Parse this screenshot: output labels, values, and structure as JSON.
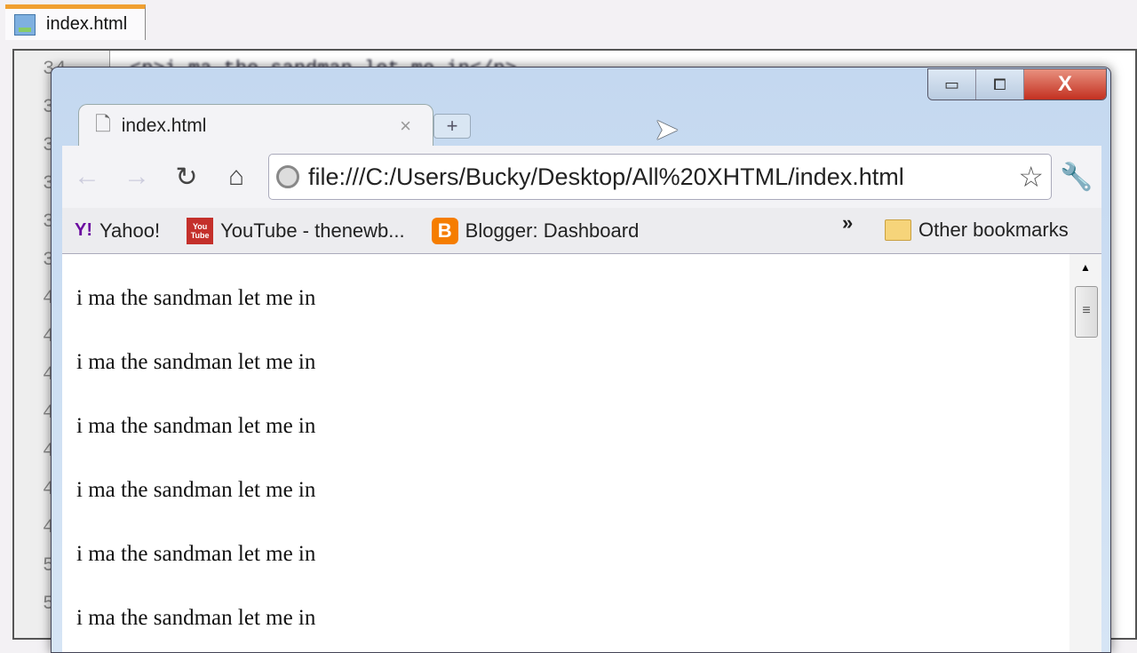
{
  "editor": {
    "tab_title": "index.html",
    "line_numbers": [
      "34",
      "3",
      "3",
      "3",
      "3",
      "3",
      "4",
      "4",
      "4",
      "4",
      "4",
      "4",
      "4",
      "5",
      "5"
    ],
    "code_line": "<p>i ma the sandman let me in</p>"
  },
  "browser": {
    "window_buttons": {
      "minimize": "▭",
      "maximize": "⧠",
      "close": "X"
    },
    "tab": {
      "title": "index.html",
      "close": "×"
    },
    "new_tab": "+",
    "address": "file:///C:/Users/Bucky/Desktop/All%20XHTML/index.html",
    "bookmarks": [
      {
        "label": "Yahoo!",
        "icon": "Y!",
        "color": "#6b0ba0"
      },
      {
        "label": "YouTube - thenewb...",
        "icon": "You Tube",
        "color": "#c4302b"
      },
      {
        "label": "Blogger: Dashboard",
        "icon": "B",
        "color": "#f57d00"
      }
    ],
    "overflow": "»",
    "other_bookmarks": "Other bookmarks",
    "paragraphs": [
      "i ma the sandman let me in",
      "i ma the sandman let me in",
      "i ma the sandman let me in",
      "i ma the sandman let me in",
      "i ma the sandman let me in",
      "i ma the sandman let me in"
    ]
  }
}
